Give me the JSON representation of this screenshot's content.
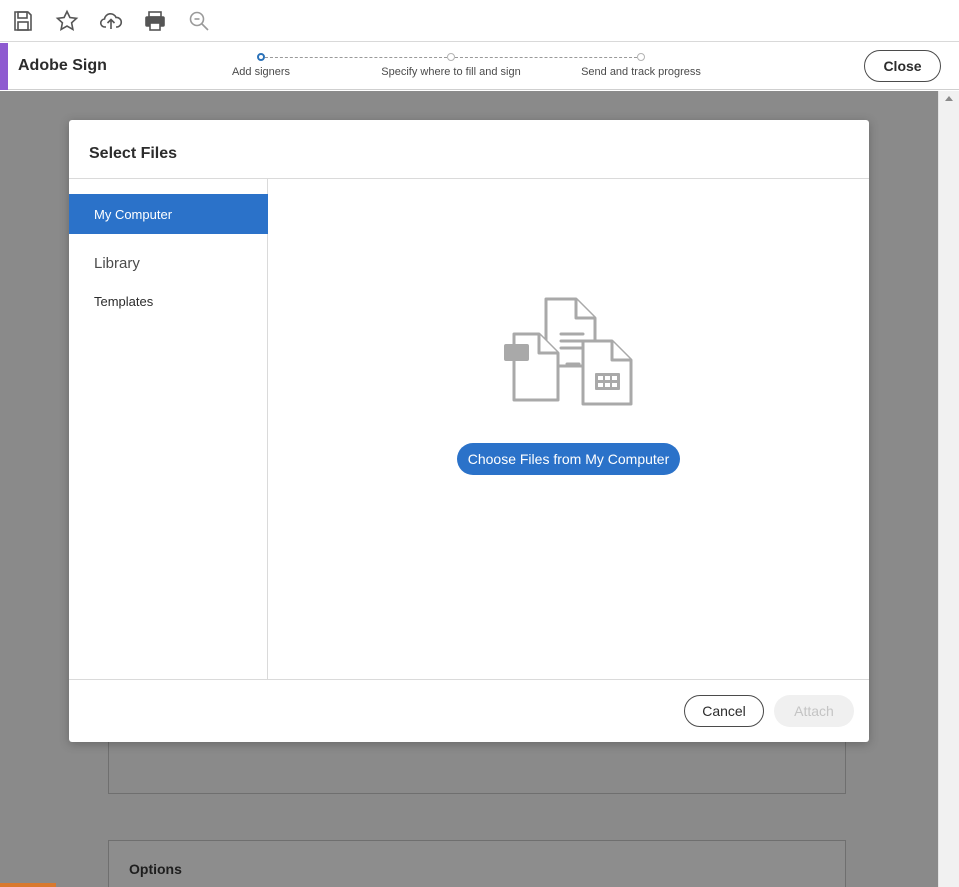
{
  "toolbar": {
    "icons": [
      "save-icon",
      "star-icon",
      "upload-cloud-icon",
      "print-icon",
      "zoom-icon"
    ]
  },
  "header": {
    "app_title": "Adobe Sign",
    "accent_color": "#8e5bd0",
    "steps": [
      {
        "label": "Add signers",
        "active": true
      },
      {
        "label": "Specify where to fill and sign",
        "active": false
      },
      {
        "label": "Send and track progress",
        "active": false
      }
    ],
    "close_label": "Close"
  },
  "background": {
    "options_label": "Options"
  },
  "dialog": {
    "title": "Select Files",
    "sidebar": [
      {
        "label": "My Computer",
        "active": true
      },
      {
        "label": "Library",
        "active": false
      },
      {
        "label": "Templates",
        "active": false
      }
    ],
    "choose_label": "Choose Files from My Computer",
    "cancel_label": "Cancel",
    "attach_label": "Attach",
    "attach_enabled": false,
    "accent_color": "#2b72c9"
  }
}
